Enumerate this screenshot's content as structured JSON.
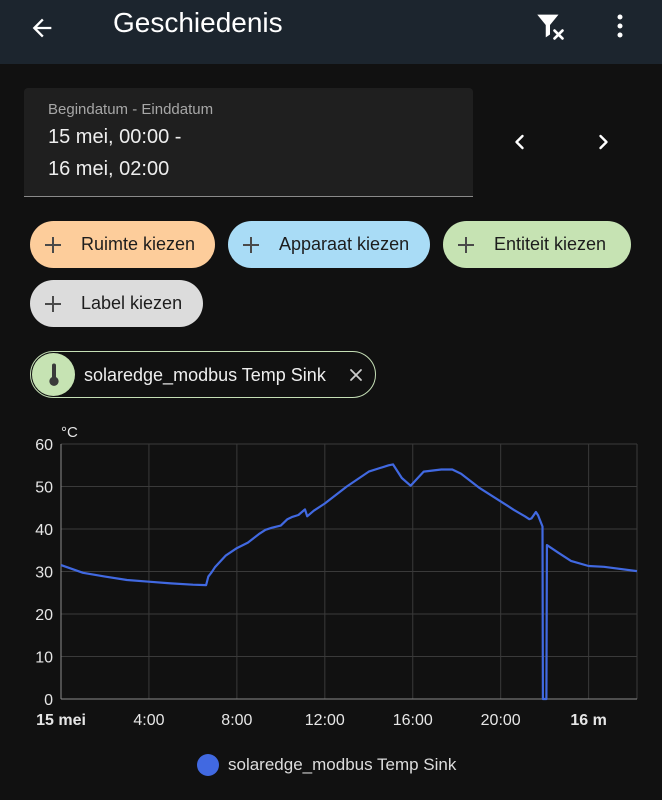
{
  "header": {
    "title": "Geschiedenis",
    "back_icon": "arrow-left-icon",
    "filter_icon": "filter-remove-icon",
    "more_icon": "dots-vertical-icon"
  },
  "date_range": {
    "label": "Begindatum - Einddatum",
    "start": "15 mei, 00:00 -",
    "end": "16 mei, 02:00",
    "prev_icon": "chevron-left-icon",
    "next_icon": "chevron-right-icon"
  },
  "target_chips": [
    {
      "label": "Ruimte kiezen",
      "color": "#fdcd9b"
    },
    {
      "label": "Apparaat kiezen",
      "color": "#a9dcf6"
    },
    {
      "label": "Entiteit kiezen",
      "color": "#c6e3b3"
    },
    {
      "label": "Label kiezen",
      "color": "#dcdcdc"
    }
  ],
  "selected_entity": {
    "name": "solaredge_modbus Temp Sink",
    "icon": "thermometer-icon",
    "remove_icon": "close-icon"
  },
  "chart_data": {
    "type": "line",
    "ylabel": "°C",
    "ylim": [
      0,
      60
    ],
    "yticks": [
      "0",
      "10",
      "20",
      "30",
      "40",
      "50",
      "60"
    ],
    "xlim": [
      0,
      26.2
    ],
    "xticks": [
      {
        "x": 0,
        "label": "15 mei",
        "bold": true
      },
      {
        "x": 4,
        "label": "4:00",
        "bold": false
      },
      {
        "x": 8,
        "label": "8:00",
        "bold": false
      },
      {
        "x": 12,
        "label": "12:00",
        "bold": false
      },
      {
        "x": 16,
        "label": "16:00",
        "bold": false
      },
      {
        "x": 20,
        "label": "20:00",
        "bold": false
      },
      {
        "x": 24,
        "label": "16 m",
        "bold": true
      }
    ],
    "grid": true,
    "series": [
      {
        "name": "solaredge_modbus Temp Sink",
        "color": "#4169e1",
        "x": [
          0,
          1,
          2,
          3,
          4,
          5,
          6,
          6.6,
          6.7,
          6.85,
          7,
          7.5,
          8,
          8.5,
          9,
          9.3,
          9.6,
          10,
          10.3,
          10.5,
          10.8,
          11.1,
          11.2,
          11.5,
          12,
          13,
          14,
          14.9,
          15.1,
          15.5,
          15.9,
          16.5,
          17.3,
          17.8,
          18.2,
          19,
          20,
          20.6,
          21.1,
          21.3,
          21.4,
          21.6,
          21.7,
          21.9,
          21.92,
          22.0,
          22.08,
          22.1,
          22.6,
          23.2,
          24,
          24.7,
          26.2
        ],
        "y": [
          31.5,
          29.7,
          28.8,
          28,
          27.6,
          27.2,
          26.9,
          26.8,
          28.8,
          29.8,
          31,
          33.8,
          35.5,
          36.8,
          38.8,
          39.8,
          40.3,
          40.8,
          42.3,
          42.8,
          43.3,
          44.6,
          43,
          44.3,
          46,
          50,
          53.5,
          55,
          55.2,
          52,
          50.2,
          53.5,
          54,
          54,
          53,
          49.8,
          46.5,
          44.5,
          43,
          42.3,
          42.5,
          44,
          43.2,
          40.6,
          0,
          0,
          0,
          36.2,
          34.5,
          32.5,
          31.3,
          31.1,
          30.1
        ]
      }
    ],
    "legend": "bottom-center"
  },
  "legend_label": "solaredge_modbus Temp Sink"
}
